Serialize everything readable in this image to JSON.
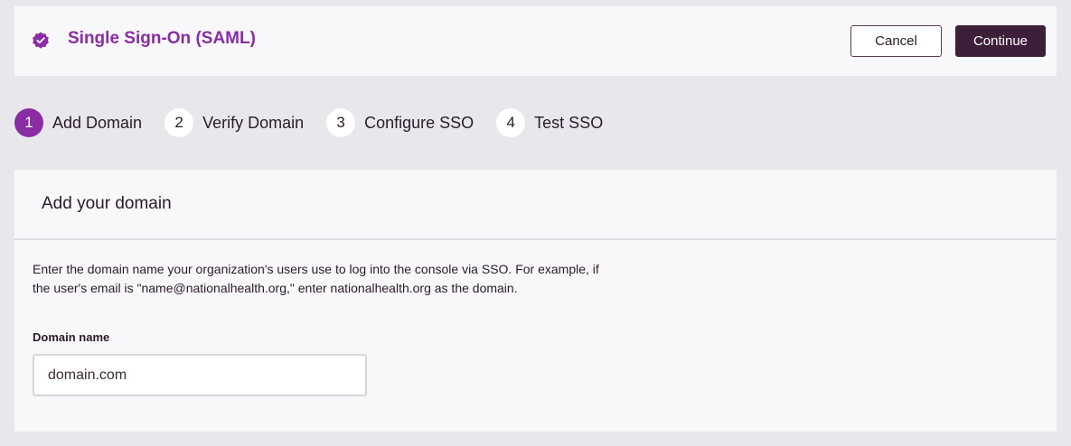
{
  "header": {
    "icon": "verified-badge-icon",
    "title": "Single Sign-On (SAML)",
    "cancel_label": "Cancel",
    "continue_label": "Continue"
  },
  "steps": [
    {
      "number": "1",
      "label": "Add Domain",
      "active": true
    },
    {
      "number": "2",
      "label": "Verify Domain",
      "active": false
    },
    {
      "number": "3",
      "label": "Configure SSO",
      "active": false
    },
    {
      "number": "4",
      "label": "Test SSO",
      "active": false
    }
  ],
  "card": {
    "title": "Add your domain",
    "description": "Enter the domain name your organization's users use to log into the console via SSO. For example, if the user's email is \"name@nationalhealth.org,\" enter nationalhealth.org as the domain.",
    "field_label": "Domain name",
    "field_value": "",
    "field_placeholder": "domain.com"
  },
  "colors": {
    "accent": "#8a2ca4",
    "primary_button": "#3e1f3a",
    "background": "#e8e8ec",
    "panel": "#f8f8fa"
  }
}
